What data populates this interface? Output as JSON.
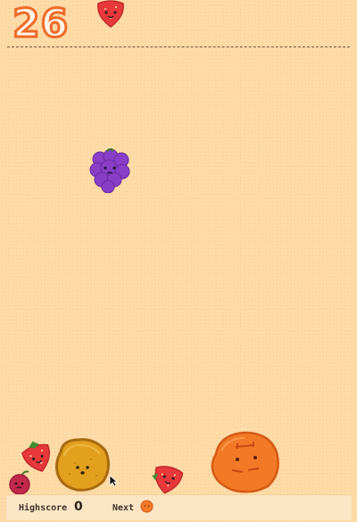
{
  "game": {
    "score": "26"
  },
  "footer": {
    "highscore_label": "Highscore",
    "highscore_value": "0",
    "next_label": "Next"
  },
  "fruits": {
    "falling": "strawberry",
    "dropping": "grape",
    "pile": [
      "strawberry",
      "cherry",
      "lemon",
      "strawberry",
      "orange"
    ],
    "next": "orange"
  },
  "colors": {
    "background": "#ffdca8",
    "score_outline": "#f06a2a",
    "strawberry": "#e8383a",
    "grape": "#8a3ec8",
    "lemon": "#e6a020",
    "orange": "#f27a26"
  }
}
